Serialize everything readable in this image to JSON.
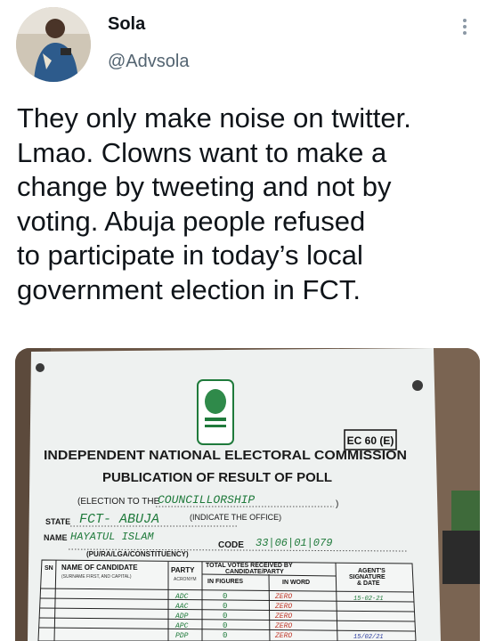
{
  "user": {
    "name": "Sola",
    "handle": "@Advsola"
  },
  "tweet": {
    "text": "They only make noise on twitter.\nLmao. Clowns want to make a\nchange by tweeting and not by\nvoting. Abuja people refused\nto participate in today’s local\ngovernment election in FCT."
  },
  "photo": {
    "form_code": "EC 60 (E)",
    "heading_1": "INDEPENDENT NATIONAL ELECTORAL COMMISSION",
    "heading_2": "PUBLICATION OF RESULT OF POLL",
    "election_label": "(ELECTION TO THE",
    "election_value": "COUNCILLORSHIP",
    "election_close": ")",
    "indicate_office": "(INDICATE THE OFFICE)",
    "state_label": "STATE",
    "state_value": "FCT- ABUJA",
    "name_label": "NAME",
    "name_value": "HAYATUL ISLAM",
    "code_label": "CODE",
    "code_value": "33|06|01|079",
    "constituency_label": "(PU/RA/LGA/CONSTITUENCY)",
    "table": {
      "col_sn": "SN",
      "col_candidate": "NAME OF CANDIDATE",
      "col_candidate_sub": "(SURNAME FIRST, AND CAPITAL)",
      "col_party": "PARTY",
      "col_party_sub": "ACRONYM",
      "col_votes": "TOTAL VOTES RECEIVED BY",
      "col_votes_2": "CANDIDATE/PARTY",
      "col_figures": "IN FIGURES",
      "col_words": "IN WORD",
      "col_agent": "AGENT'S",
      "col_agent_2": "SIGNATURE",
      "col_agent_3": "& DATE",
      "rows": [
        {
          "party": "ADC",
          "figure": "0",
          "word": "ZERO",
          "sign": "15-02-21"
        },
        {
          "party": "AAC",
          "figure": "0",
          "word": "ZERO",
          "sign": ""
        },
        {
          "party": "ADP",
          "figure": "0",
          "word": "ZERO",
          "sign": ""
        },
        {
          "party": "APC",
          "figure": "0",
          "word": "ZERO",
          "sign": ""
        },
        {
          "party": "PDP",
          "figure": "0",
          "word": "ZERO",
          "sign": "15/02/21"
        }
      ]
    }
  },
  "colors": {
    "text": "#0f1419",
    "secondary": "#536471",
    "paper": "#eef1f0",
    "ink_green": "#1f7a3b",
    "pen_blue": "#2a3b9e"
  }
}
